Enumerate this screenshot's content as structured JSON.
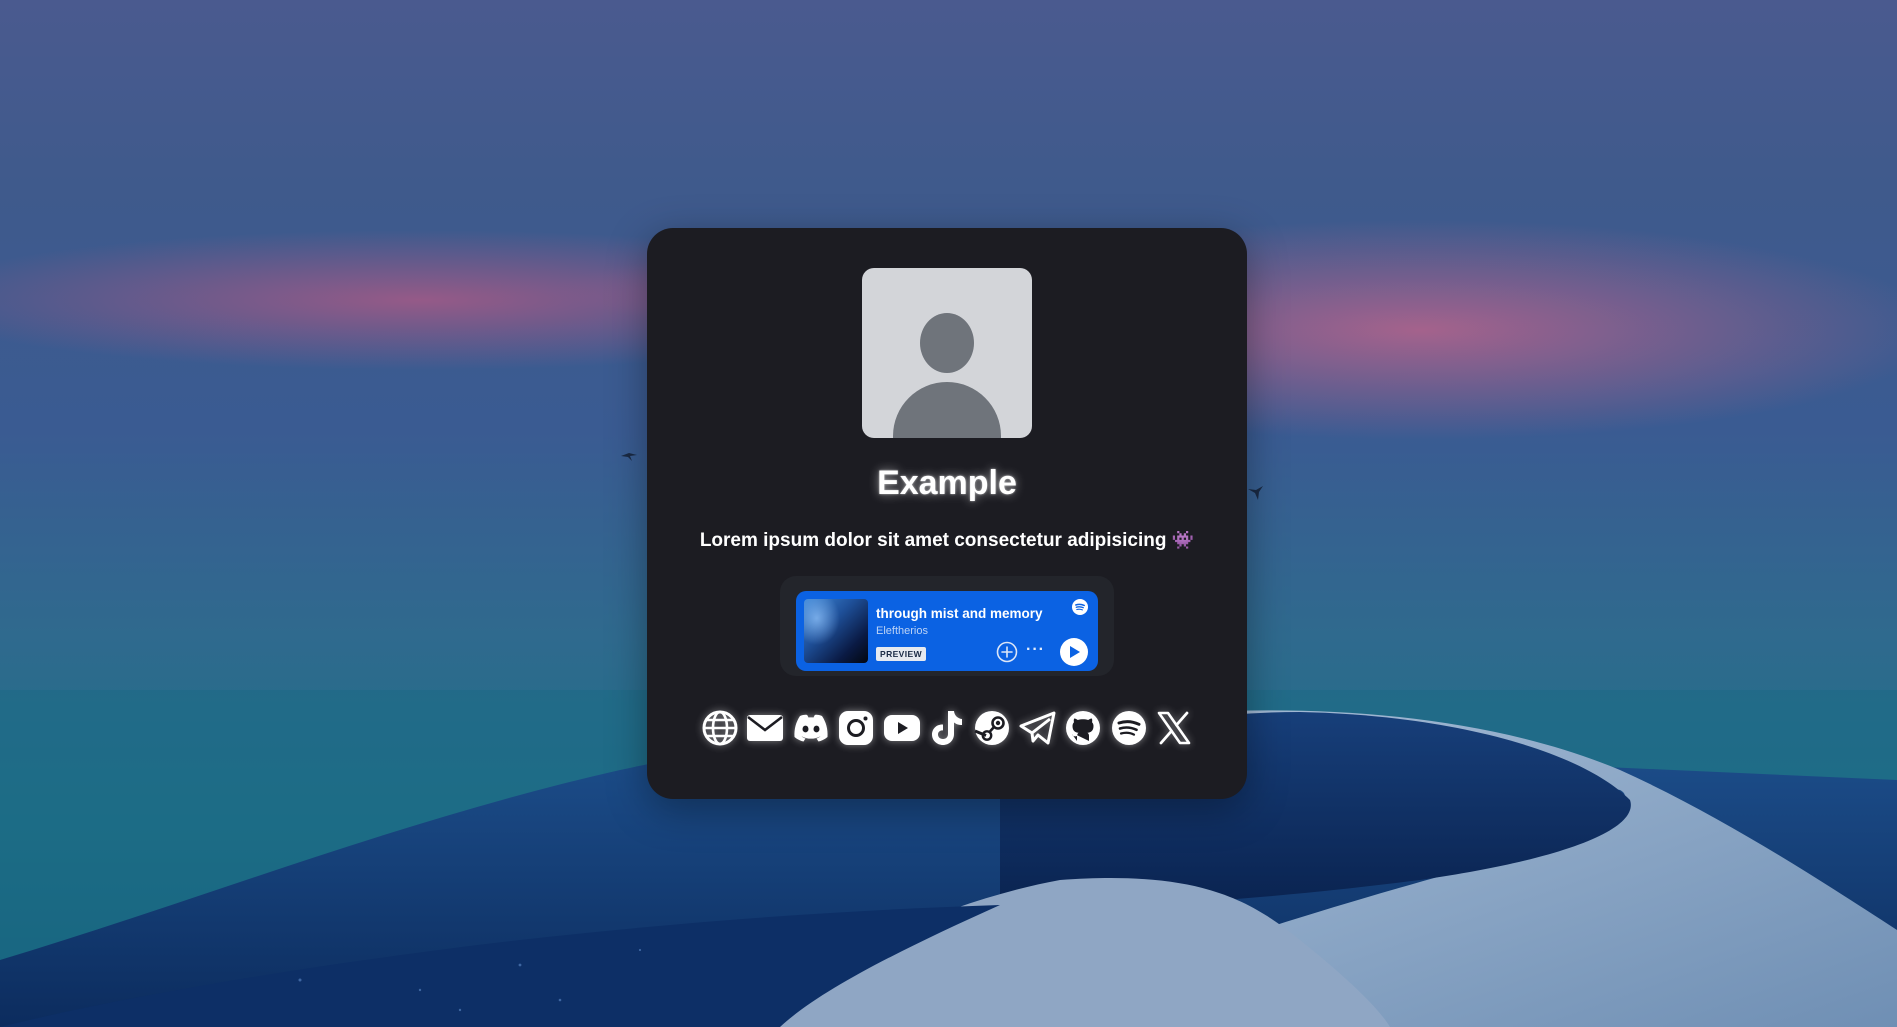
{
  "profile": {
    "name": "Example",
    "bio": "Lorem ipsum dolor sit amet consectetur adipisicing",
    "bio_emoji": "👾"
  },
  "player": {
    "title": "through mist and memory",
    "artist": "Eleftherios",
    "badge": "PREVIEW",
    "accent": "#0b62e3"
  },
  "socials": [
    {
      "name": "website",
      "icon": "globe-icon"
    },
    {
      "name": "email",
      "icon": "mail-icon"
    },
    {
      "name": "discord",
      "icon": "discord-icon"
    },
    {
      "name": "instagram",
      "icon": "instagram-icon"
    },
    {
      "name": "youtube",
      "icon": "youtube-icon"
    },
    {
      "name": "tiktok",
      "icon": "tiktok-icon"
    },
    {
      "name": "steam",
      "icon": "steam-icon"
    },
    {
      "name": "telegram",
      "icon": "telegram-icon"
    },
    {
      "name": "github",
      "icon": "github-icon"
    },
    {
      "name": "spotify",
      "icon": "spotify-icon"
    },
    {
      "name": "x",
      "icon": "x-icon"
    }
  ],
  "colors": {
    "card": "#1c1c22",
    "icon": "#ffffff"
  }
}
